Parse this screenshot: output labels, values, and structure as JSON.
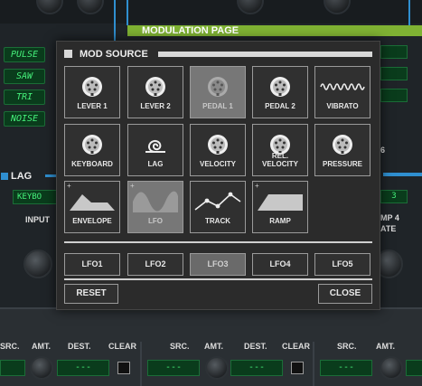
{
  "background": {
    "modulation_page_title": "MODULATION PAGE",
    "waveforms": [
      "PULSE",
      "SAW",
      "TRI",
      "NOISE"
    ],
    "lag_title": "LAG",
    "lag_source_value": "KEYBO",
    "lag_input_label": "INPUT",
    "right_value": "3",
    "right_label_top": "6",
    "right_label_mid": "MP 4",
    "right_label_bot": "ATE",
    "bottom_labels": {
      "src": "SRC.",
      "amt": "AMT.",
      "dest": "DEST.",
      "clear": "CLEAR"
    },
    "bottom_field_value": "---",
    "accent_colors": {
      "blue": "#2f8fd0",
      "green": "#7fb233",
      "lcd_text": "#45f07a"
    }
  },
  "modal": {
    "title": "MOD SOURCE",
    "sources": [
      {
        "label": "LEVER 1",
        "icon": "din-connector-icon",
        "selected": false
      },
      {
        "label": "LEVER 2",
        "icon": "din-connector-icon",
        "selected": false
      },
      {
        "label": "PEDAL 1",
        "icon": "din-connector-icon",
        "selected": true
      },
      {
        "label": "PEDAL 2",
        "icon": "din-connector-icon",
        "selected": false
      },
      {
        "label": "VIBRATO",
        "icon": "vibrato-wave-icon",
        "selected": false
      },
      {
        "label": "KEYBOARD",
        "icon": "din-connector-icon",
        "selected": false
      },
      {
        "label": "LAG",
        "icon": "lag-spiral-icon",
        "selected": false
      },
      {
        "label": "VELOCITY",
        "icon": "din-connector-icon",
        "selected": false
      },
      {
        "label": "REL. VELOCITY",
        "icon": "din-connector-icon",
        "selected": false
      },
      {
        "label": "PRESSURE",
        "icon": "din-connector-icon",
        "selected": false
      },
      {
        "label": "ENVELOPE",
        "icon": "envelope-shape-icon",
        "selected": false
      },
      {
        "label": "LFO",
        "icon": "sine-wave-icon",
        "selected": true
      },
      {
        "label": "TRACK",
        "icon": "track-graph-icon",
        "selected": false
      },
      {
        "label": "RAMP",
        "icon": "ramp-shape-icon",
        "selected": false
      }
    ],
    "lfo_buttons": [
      {
        "label": "LFO1",
        "selected": false
      },
      {
        "label": "LFO2",
        "selected": false
      },
      {
        "label": "LFO3",
        "selected": true
      },
      {
        "label": "LFO4",
        "selected": false
      },
      {
        "label": "LFO5",
        "selected": false
      }
    ],
    "reset_label": "RESET",
    "close_label": "CLOSE"
  }
}
